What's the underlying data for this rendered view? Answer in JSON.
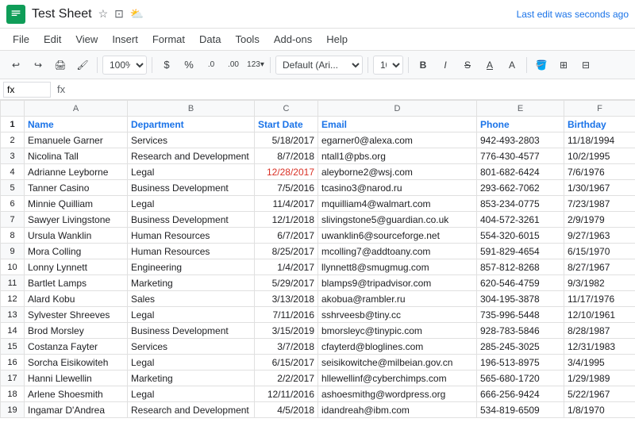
{
  "titlebar": {
    "title": "Test Sheet",
    "last_edit": "Last edit was seconds ago",
    "icons": [
      "star",
      "folder",
      "cloud"
    ]
  },
  "menubar": {
    "items": [
      "File",
      "Edit",
      "View",
      "Insert",
      "Format",
      "Data",
      "Tools",
      "Add-ons",
      "Help"
    ]
  },
  "toolbar": {
    "zoom": "100%",
    "currency": "$",
    "percent": "%",
    "decimal_less": ".0",
    "decimal_more": ".00",
    "format_num": "123",
    "font": "Default (Ari...",
    "size": "10",
    "bold": "B",
    "italic": "I",
    "strikethrough": "S"
  },
  "formulabar": {
    "cell_ref": "fx"
  },
  "columns": {
    "headers": [
      "",
      "A",
      "B",
      "C",
      "D",
      "E",
      "F"
    ],
    "labels": [
      "",
      "Name",
      "Department",
      "Start Date",
      "Email",
      "Phone",
      "Birthday"
    ]
  },
  "rows": [
    {
      "num": 1,
      "name": "Name",
      "dept": "Department",
      "start": "Start Date",
      "email": "Email",
      "phone": "Phone",
      "bday": "Birthday",
      "header": true
    },
    {
      "num": 2,
      "name": "Emanuele Garner",
      "dept": "Services",
      "start": "5/18/2017",
      "email": "egarner0@alexa.com",
      "phone": "942-493-2803",
      "bday": "11/18/1994"
    },
    {
      "num": 3,
      "name": "Nicolina Tall",
      "dept": "Research and Development",
      "start": "8/7/2018",
      "email": "ntall1@pbs.org",
      "phone": "776-430-4577",
      "bday": "10/2/1995"
    },
    {
      "num": 4,
      "name": "Adrianne Leyborne",
      "dept": "Legal",
      "start": "12/28/2017",
      "email": "aleyborne2@wsj.com",
      "phone": "801-682-6424",
      "bday": "7/6/1976",
      "highlight": true
    },
    {
      "num": 5,
      "name": "Tanner Casino",
      "dept": "Business Development",
      "start": "7/5/2016",
      "email": "tcasino3@narod.ru",
      "phone": "293-662-7062",
      "bday": "1/30/1967"
    },
    {
      "num": 6,
      "name": "Minnie Quilliam",
      "dept": "Legal",
      "start": "11/4/2017",
      "email": "mquilliam4@walmart.com",
      "phone": "853-234-0775",
      "bday": "7/23/1987"
    },
    {
      "num": 7,
      "name": "Sawyer Livingstone",
      "dept": "Business Development",
      "start": "12/1/2018",
      "email": "slivingstone5@guardian.co.uk",
      "phone": "404-572-3261",
      "bday": "2/9/1979"
    },
    {
      "num": 8,
      "name": "Ursula Wanklin",
      "dept": "Human Resources",
      "start": "6/7/2017",
      "email": "uwanklin6@sourceforge.net",
      "phone": "554-320-6015",
      "bday": "9/27/1963"
    },
    {
      "num": 9,
      "name": "Mora Colling",
      "dept": "Human Resources",
      "start": "8/25/2017",
      "email": "mcolling7@addtoany.com",
      "phone": "591-829-4654",
      "bday": "6/15/1970"
    },
    {
      "num": 10,
      "name": "Lonny Lynnett",
      "dept": "Engineering",
      "start": "1/4/2017",
      "email": "llynnett8@smugmug.com",
      "phone": "857-812-8268",
      "bday": "8/27/1967"
    },
    {
      "num": 11,
      "name": "Bartlet Lamps",
      "dept": "Marketing",
      "start": "5/29/2017",
      "email": "blamps9@tripadvisor.com",
      "phone": "620-546-4759",
      "bday": "9/3/1982"
    },
    {
      "num": 12,
      "name": "Alard Kobu",
      "dept": "Sales",
      "start": "3/13/2018",
      "email": "akobua@rambler.ru",
      "phone": "304-195-3878",
      "bday": "11/17/1976"
    },
    {
      "num": 13,
      "name": "Sylvester Shreeves",
      "dept": "Legal",
      "start": "7/11/2016",
      "email": "sshrveesb@tiny.cc",
      "phone": "735-996-5448",
      "bday": "12/10/1961"
    },
    {
      "num": 14,
      "name": "Brod Morsley",
      "dept": "Business Development",
      "start": "3/15/2019",
      "email": "bmorsleyc@tinypic.com",
      "phone": "928-783-5846",
      "bday": "8/28/1987"
    },
    {
      "num": 15,
      "name": "Costanza Fayter",
      "dept": "Services",
      "start": "3/7/2018",
      "email": "cfayterd@bloglines.com",
      "phone": "285-245-3025",
      "bday": "12/31/1983"
    },
    {
      "num": 16,
      "name": "Sorcha Eisikowiteh",
      "dept": "Legal",
      "start": "6/15/2017",
      "email": "seisikowitche@milbeian.gov.cn",
      "phone": "196-513-8975",
      "bday": "3/4/1995"
    },
    {
      "num": 17,
      "name": "Hanni Llewellin",
      "dept": "Marketing",
      "start": "2/2/2017",
      "email": "hllewellinf@cyberchimps.com",
      "phone": "565-680-1720",
      "bday": "1/29/1989"
    },
    {
      "num": 18,
      "name": "Arlene Shoesmith",
      "dept": "Legal",
      "start": "12/11/2016",
      "email": "ashoesmithg@wordpress.org",
      "phone": "666-256-9424",
      "bday": "5/22/1967"
    },
    {
      "num": 19,
      "name": "Ingamar D'Andrea",
      "dept": "Research and Development",
      "start": "4/5/2018",
      "email": "idandreah@ibm.com",
      "phone": "534-819-6509",
      "bday": "1/8/1970"
    }
  ]
}
